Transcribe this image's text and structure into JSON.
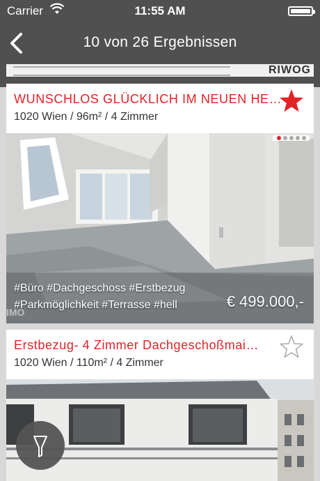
{
  "status_bar": {
    "carrier": "Carrier",
    "time": "11:55 AM"
  },
  "nav": {
    "title": "10 von 26 Ergebnissen"
  },
  "prev_image": {
    "logo_text": "RIWOG"
  },
  "listings": [
    {
      "title": "WUNSCHLOS GLÜCKLICH IM NEUEN HE…",
      "subtitle": "1020 Wien / 96m² / 4 Zimmer",
      "favorite": true,
      "image_index": "1 of 5",
      "tags_line1": "#Büro #Dachgeschoss #Erstbezug",
      "tags_line2": "#Parkmöglichkeit #Terrasse #hell",
      "price": "€ 499.000,-"
    },
    {
      "title": "Erstbezug- 4 Zimmer Dachgeschoßmai…",
      "subtitle": "1020 Wien / 110m² / 4 Zimmer",
      "favorite": false
    }
  ],
  "colors": {
    "accent": "#e32226",
    "nav_bg": "#505050"
  }
}
